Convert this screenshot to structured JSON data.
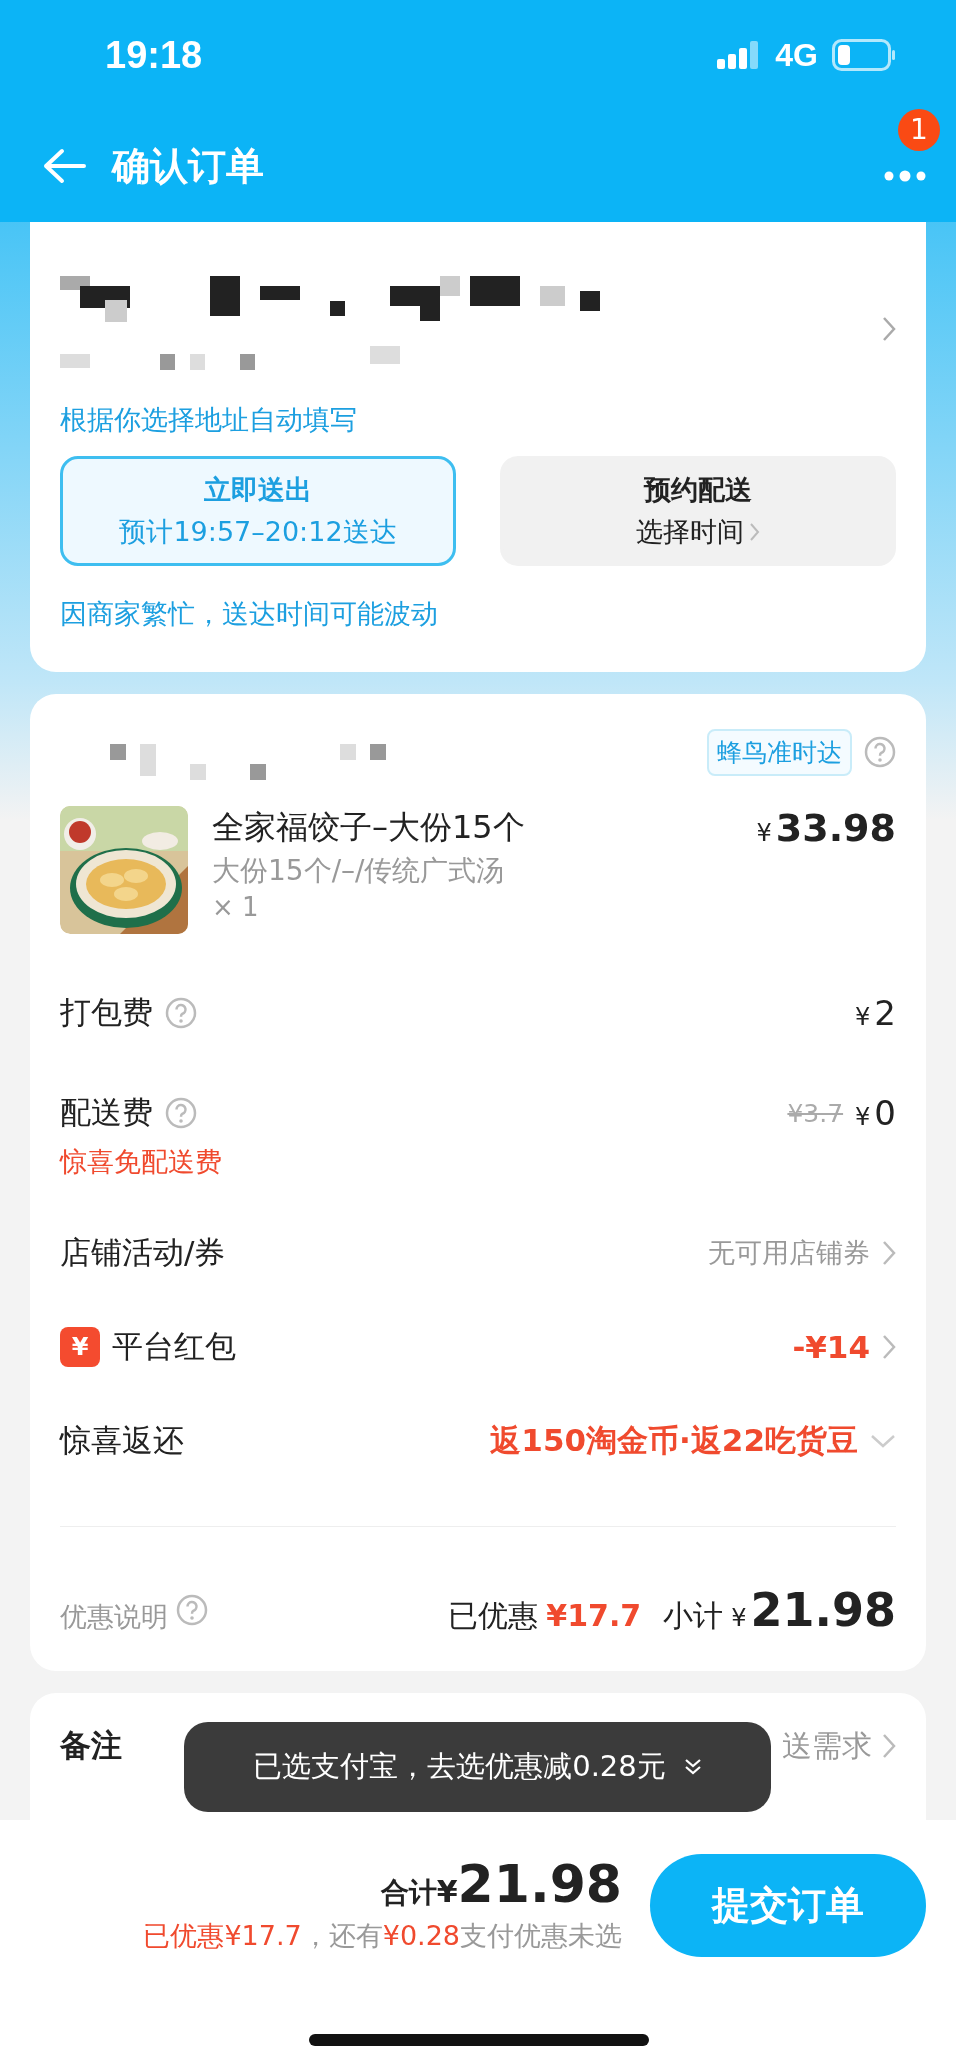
{
  "status_bar": {
    "time": "19:18",
    "network": "4G"
  },
  "nav": {
    "title": "确认订单",
    "badge": "1"
  },
  "address": {
    "hint": "根据你选择地址自动填写",
    "notice": "因商家繁忙，送达时间可能波动"
  },
  "delivery_options": [
    {
      "title": "立即送出",
      "subtitle": "预计19:57–20:12送达",
      "selected": true
    },
    {
      "title": "预约配送",
      "subtitle": "选择时间",
      "selected": false
    }
  ],
  "store": {
    "tag": "蜂鸟准时达",
    "item": {
      "name": "全家福饺子–大份15个",
      "spec": "大份15个/–/传统广式汤",
      "quantity": "× 1",
      "currency": "¥",
      "price": "33.98"
    }
  },
  "rows": [
    {
      "kind": "fee",
      "label": "打包费",
      "currency": "¥",
      "amount": "2"
    },
    {
      "kind": "fee",
      "label": "配送费",
      "original": "¥3.7",
      "currency": "¥",
      "amount": "0",
      "note": "惊喜免配送费"
    },
    {
      "kind": "link",
      "label": "店铺活动/券",
      "value": "无可用店铺券"
    },
    {
      "kind": "redpacket",
      "icon": "¥",
      "label": "平台红包",
      "value": "-¥14"
    },
    {
      "kind": "dropdown",
      "label": "惊喜返还",
      "value": "返150淘金币·返22吃货豆"
    }
  ],
  "summary": {
    "label": "优惠说明",
    "saved_label": "已优惠",
    "saved": "¥17.7",
    "subtotal_label": "小计",
    "currency": "¥",
    "subtotal": "21.98"
  },
  "remark": {
    "label": "备注",
    "placeholder": "送需求"
  },
  "toast": {
    "text": "已选支付宝，去选优惠减0.28元"
  },
  "footer": {
    "total_label": "合计",
    "currency": "¥",
    "total": "21.98",
    "note": [
      {
        "text": "已优惠¥17.7",
        "kind": "highlight"
      },
      {
        "text": "，还有",
        "kind": "plain"
      },
      {
        "text": "¥0.28",
        "kind": "highlight"
      },
      {
        "text": "支付优惠未选",
        "kind": "plain"
      }
    ],
    "submit": "提交订单"
  }
}
